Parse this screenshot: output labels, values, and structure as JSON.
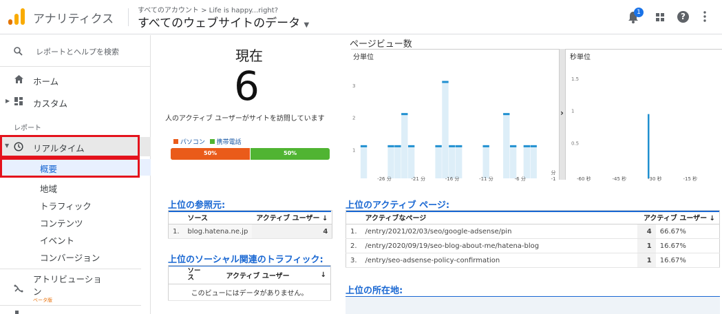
{
  "header": {
    "app_title": "アナリティクス",
    "account_breadcrumb": "すべてのアカウント > Life is happy...right?",
    "view_name": "すべてのウェブサイトのデータ",
    "notification_count": "1",
    "help_label": "?"
  },
  "sidebar": {
    "search_placeholder": "レポートとヘルプを検索",
    "home": "ホーム",
    "custom": "カスタム",
    "reports_section": "レポート",
    "realtime": "リアルタイム",
    "realtime_children": [
      "概要",
      "地域",
      "トラフィック",
      "コンテンツ",
      "イベント",
      "コンバージョン"
    ],
    "attribution": "アトリビューション",
    "beta": "ベータ版"
  },
  "now_panel": {
    "title": "現在",
    "active_users": "6",
    "caption": "人のアクティブ ユーザーがサイトを訪問しています",
    "legend_desktop": "パソコン",
    "legend_mobile": "携帯電話",
    "desktop_pct": "50%",
    "mobile_pct": "50%",
    "desktop_fraction": 0.5,
    "colors": {
      "desktop": "#ea5b1a",
      "mobile": "#50b432"
    }
  },
  "pageviews": {
    "title": "ページビュー数",
    "per_minute_label": "分単位",
    "per_second_label": "秒単位",
    "expand_arrow": "›",
    "bar_color": "#1f8fd0",
    "bar_fill_color": "#ddeef8"
  },
  "chart_data": [
    {
      "type": "bar",
      "title": "分単位",
      "x": [
        -30,
        -29,
        -28,
        -27,
        -26,
        -25,
        -24,
        -23,
        -22,
        -21,
        -20,
        -19,
        -18,
        -17,
        -16,
        -15,
        -14,
        -13,
        -12,
        -11,
        -10,
        -9,
        -8,
        -7,
        -6,
        -5,
        -4,
        -3,
        -2,
        -1
      ],
      "values": [
        0,
        1,
        0,
        0,
        0,
        1,
        1,
        2,
        1,
        0,
        0,
        0,
        1,
        3,
        1,
        1,
        0,
        0,
        0,
        1,
        0,
        0,
        2,
        1,
        0,
        1,
        1,
        0,
        0,
        0
      ],
      "xticks": [
        "-26 分",
        "-21 分",
        "-16 分",
        "-11 分",
        "-6 分",
        "分 -1"
      ],
      "yticks": [
        "1",
        "2",
        "3"
      ],
      "ylim": [
        0,
        3
      ]
    },
    {
      "type": "bar",
      "title": "秒単位",
      "x": [
        -60,
        -30
      ],
      "values": [
        0,
        1
      ],
      "xticks": [
        "-60 秒",
        "-45 秒",
        "-30 秒",
        "-15 秒"
      ],
      "yticks": [
        "0.5",
        "1",
        "1.5"
      ],
      "ylim": [
        0,
        1.5
      ]
    }
  ],
  "referrals": {
    "title": "上位の参照元:",
    "col_source": "ソース",
    "col_users": "アクティブ ユーザー",
    "sort_arrow": "↓",
    "rows": [
      {
        "idx": "1.",
        "source": "blog.hatena.ne.jp",
        "users": "4"
      }
    ]
  },
  "social": {
    "title": "上位のソーシャル関連のトラフィック:",
    "col_source": "ソース",
    "col_users": "アクティブ ユーザー",
    "sort_arrow": "↓",
    "empty_message": "このビューにはデータがありません。"
  },
  "pages": {
    "title": "上位のアクティブ ページ:",
    "col_page": "アクティブなページ",
    "col_users": "アクティブ ユーザー",
    "sort_arrow": "↓",
    "rows": [
      {
        "idx": "1.",
        "page": "/entry/2021/02/03/seo/google-adsense/pin",
        "users": "4",
        "pct": "66.67%"
      },
      {
        "idx": "2.",
        "page": "/entry/2020/09/19/seo-blog-about-me/hatena-blog",
        "users": "1",
        "pct": "16.67%"
      },
      {
        "idx": "3.",
        "page": "/entry/seo-adsense-policy-confirmation",
        "users": "1",
        "pct": "16.67%"
      }
    ]
  },
  "locations": {
    "title": "上位の所在地:"
  }
}
